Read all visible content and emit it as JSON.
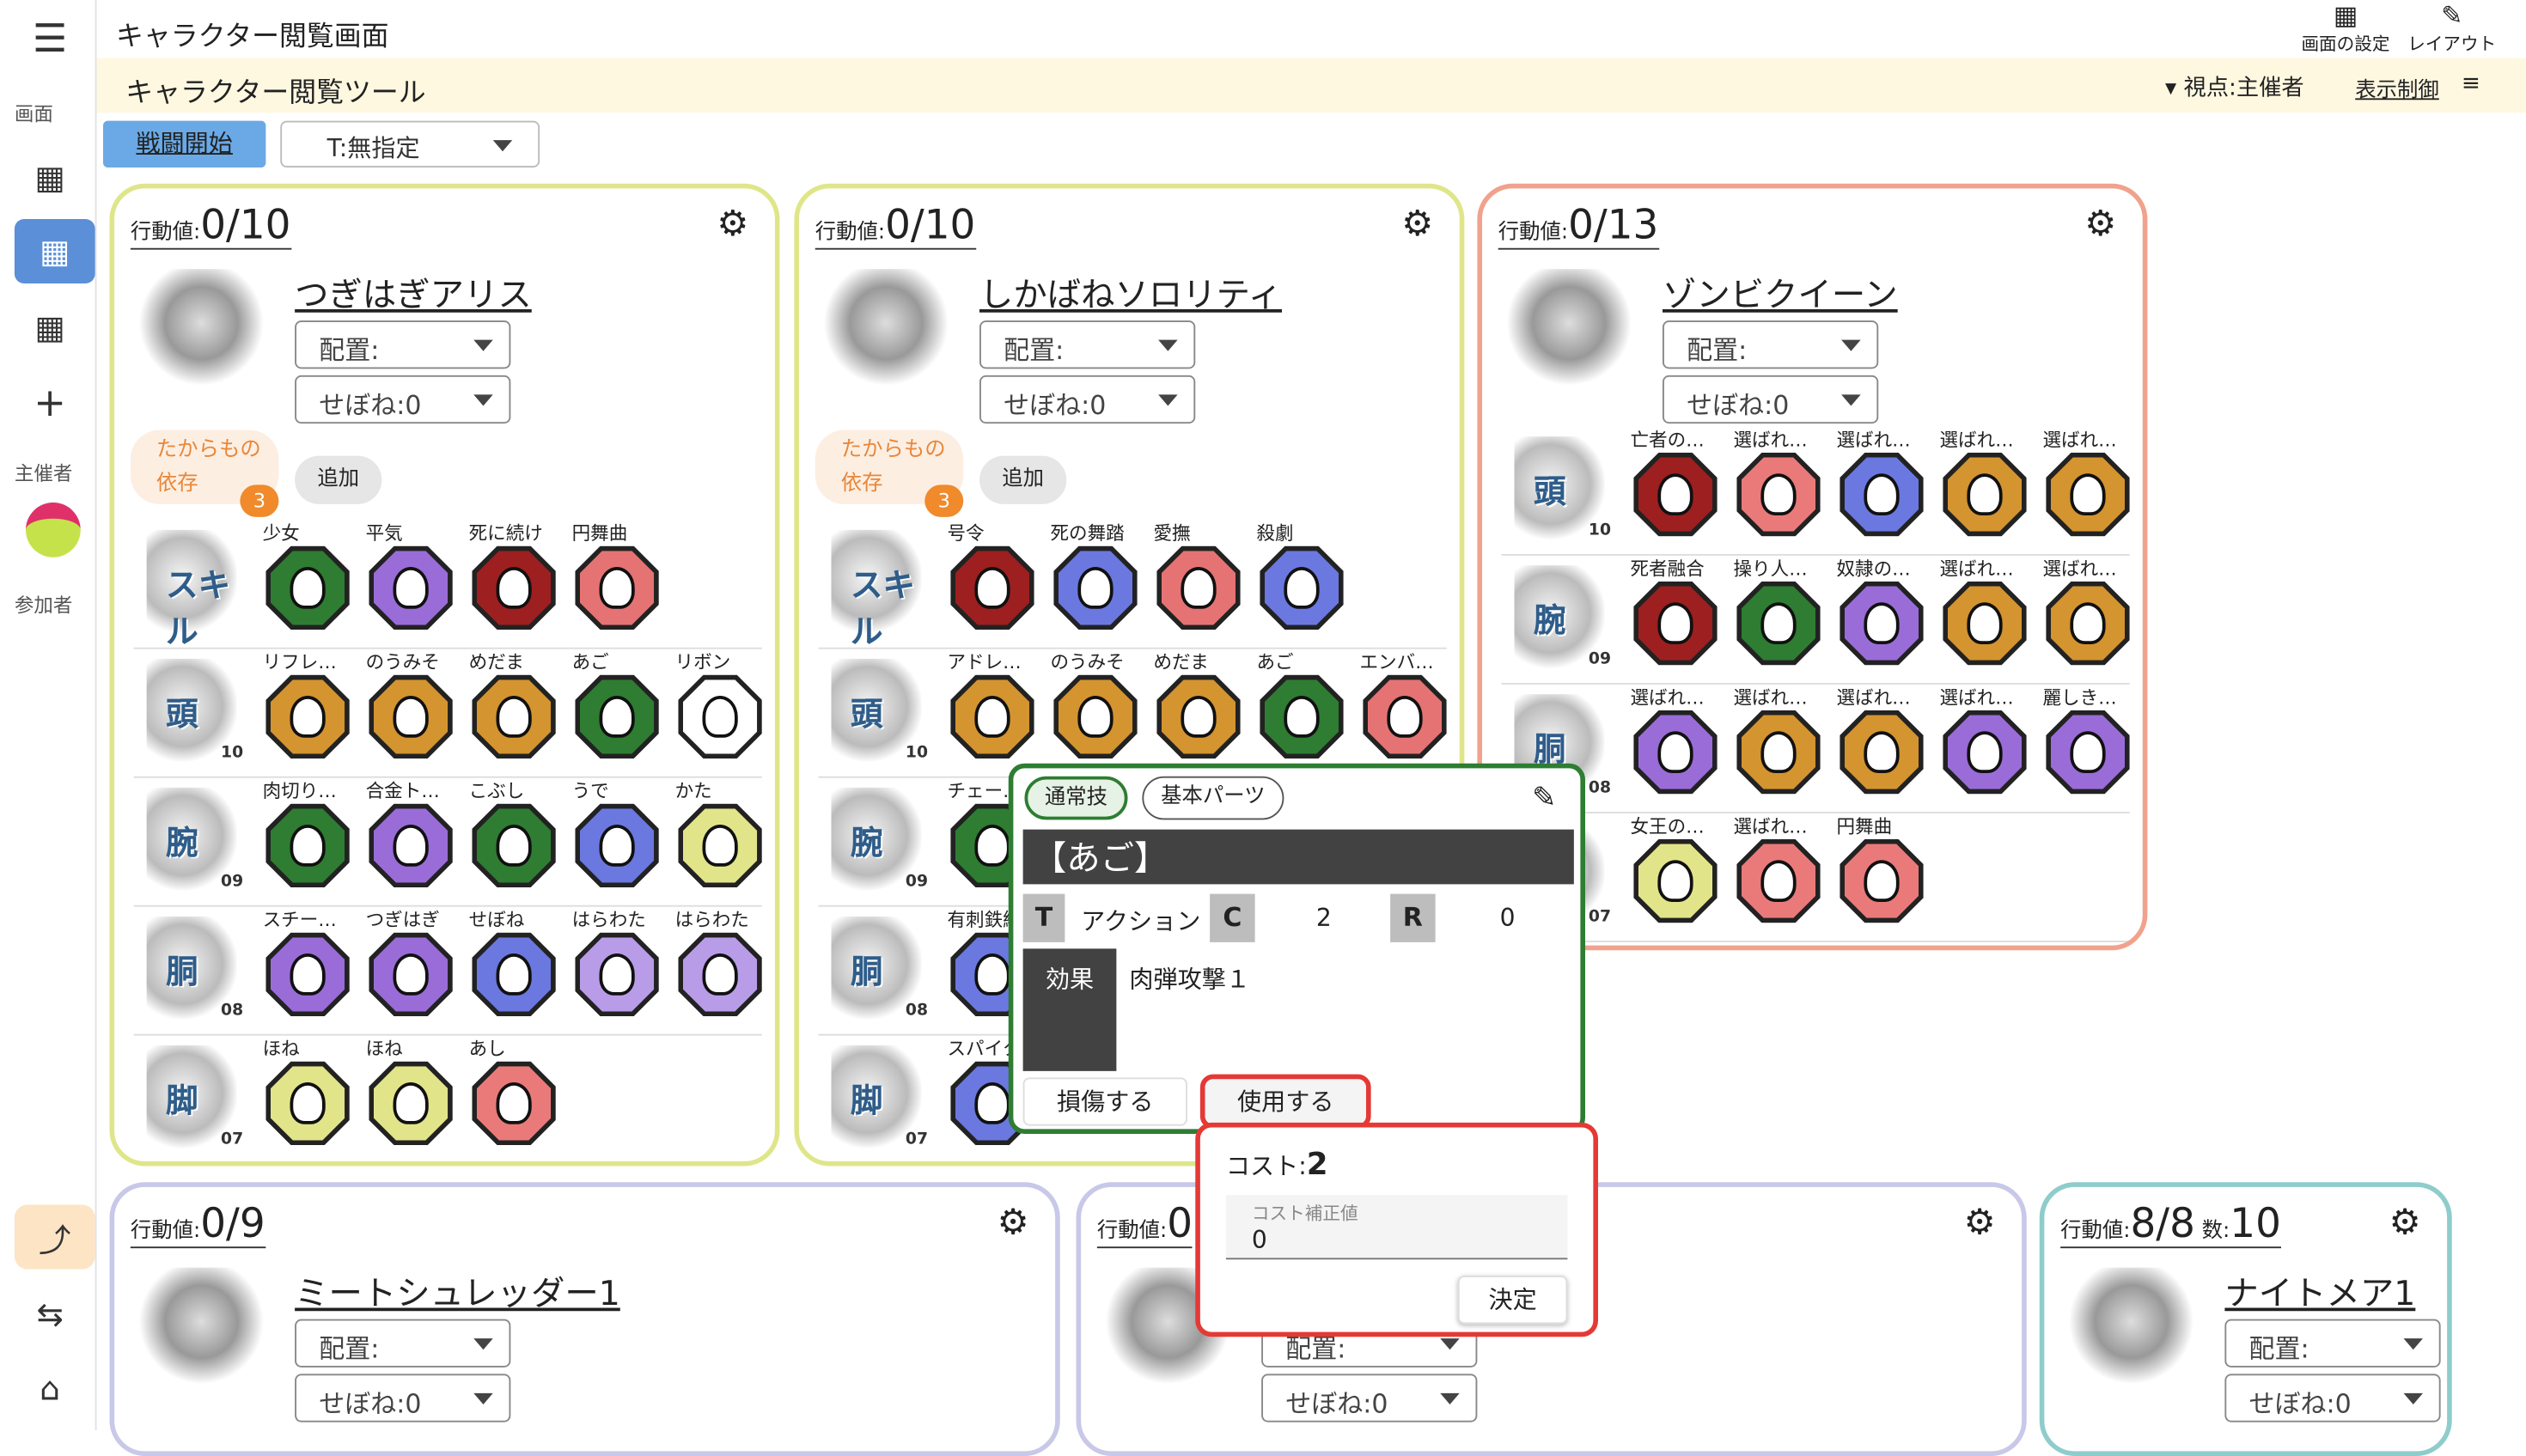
{
  "app": {
    "title": "キャラクター閲覧画面",
    "subtitle": "キャラクター閲覧ツール",
    "top_actions": [
      {
        "label": "画面の設定",
        "icon": "grid-icon"
      },
      {
        "label": "レイアウト",
        "icon": "tools-icon"
      }
    ],
    "viewpoint": "▾ 視点:主催者",
    "display_control": "表示制御",
    "battle_start": "戦闘開始",
    "timing_select": "T:無指定"
  },
  "rail": {
    "section_screen": "画面",
    "section_host": "主催者",
    "section_participant": "参加者"
  },
  "colors": {
    "accent": "#5b9bd5",
    "green": "#2e7d32",
    "red": "#e53935",
    "yellowBorder": "#dfe68a",
    "salmonBorder": "#f0a28d",
    "lavenderBorder": "#c8c8e8",
    "tealBorder": "#8fcccc"
  },
  "common": {
    "action_label": "行動値:",
    "place": "配置:",
    "sebone": "せぼね:0",
    "treasure": "たからもの\n依存",
    "treasure_count": "3",
    "add": "追加",
    "count_label": "数:"
  },
  "cards": [
    {
      "name": "つぎはぎアリス",
      "action": "0/10",
      "rows": [
        {
          "kind": "skill",
          "glyph": "スキル",
          "num": "",
          "parts": [
            [
              "少女",
              "#2e7d32"
            ],
            [
              "平気",
              "#9a6cd8"
            ],
            [
              "死に続け",
              "#9e1f1f"
            ],
            [
              "円舞曲",
              "#e57373"
            ]
          ]
        },
        {
          "kind": "head",
          "glyph": "頭",
          "num": "10",
          "parts": [
            [
              "リフレ…",
              "#d4942f"
            ],
            [
              "のうみそ",
              "#d4942f"
            ],
            [
              "めだま",
              "#d4942f"
            ],
            [
              "あご",
              "#2e7d32"
            ],
            [
              "リボン",
              "#ffffff"
            ]
          ]
        },
        {
          "kind": "arm",
          "glyph": "腕",
          "num": "09",
          "parts": [
            [
              "肉切り…",
              "#2e7d32"
            ],
            [
              "合金ト…",
              "#9a6cd8"
            ],
            [
              "こぶし",
              "#2e7d32"
            ],
            [
              "うで",
              "#6b78e0"
            ],
            [
              "かた",
              "#e2e48a"
            ]
          ]
        },
        {
          "kind": "body",
          "glyph": "胴",
          "num": "08",
          "parts": [
            [
              "スチー…",
              "#9a6cd8"
            ],
            [
              "つぎはぎ",
              "#9a6cd8"
            ],
            [
              "せぼね",
              "#6b78e0"
            ],
            [
              "はらわた",
              "#b99ce8"
            ],
            [
              "はらわた",
              "#b99ce8"
            ]
          ]
        },
        {
          "kind": "leg",
          "glyph": "脚",
          "num": "07",
          "parts": [
            [
              "ほね",
              "#e2e48a"
            ],
            [
              "ほね",
              "#e2e48a"
            ],
            [
              "あし",
              "#ea7a7a"
            ]
          ]
        }
      ]
    },
    {
      "name": "しかばねソロリティ",
      "action": "0/10",
      "rows": [
        {
          "kind": "skill",
          "glyph": "スキル",
          "num": "",
          "parts": [
            [
              "号令",
              "#9e1f1f"
            ],
            [
              "死の舞踏",
              "#6b78e0"
            ],
            [
              "愛撫",
              "#e57373"
            ],
            [
              "殺劇",
              "#6b78e0"
            ]
          ]
        },
        {
          "kind": "head",
          "glyph": "頭",
          "num": "10",
          "parts": [
            [
              "アドレ…",
              "#d4942f"
            ],
            [
              "のうみそ",
              "#d4942f"
            ],
            [
              "めだま",
              "#d4942f"
            ],
            [
              "あご",
              "#2e7d32"
            ],
            [
              "エンバ…",
              "#e57373"
            ]
          ]
        },
        {
          "kind": "arm",
          "glyph": "腕",
          "num": "09",
          "parts": [
            [
              "チェー…",
              "#2e7d32"
            ]
          ]
        },
        {
          "kind": "body",
          "glyph": "胴",
          "num": "08",
          "parts": [
            [
              "有刺鉄線",
              "#6b78e0"
            ]
          ]
        },
        {
          "kind": "leg",
          "glyph": "脚",
          "num": "07",
          "parts": [
            [
              "スパイク",
              "#6b78e0"
            ]
          ]
        }
      ]
    },
    {
      "name": "ゾンビクイーン",
      "action": "0/13",
      "rows": [
        {
          "kind": "head",
          "glyph": "頭",
          "num": "10",
          "parts": [
            [
              "亡者の…",
              "#9e1f1f"
            ],
            [
              "選ばれ…",
              "#ea7a7a"
            ],
            [
              "選ばれ…",
              "#6b78e0"
            ],
            [
              "選ばれ…",
              "#d4942f"
            ],
            [
              "選ばれ…",
              "#d4942f"
            ]
          ]
        },
        {
          "kind": "arm",
          "glyph": "腕",
          "num": "09",
          "parts": [
            [
              "死者融合",
              "#9e1f1f"
            ],
            [
              "操り人…",
              "#2e7d32"
            ],
            [
              "奴隷の…",
              "#9a6cd8"
            ],
            [
              "選ばれ…",
              "#d4942f"
            ],
            [
              "選ばれ…",
              "#d4942f"
            ]
          ]
        },
        {
          "kind": "body",
          "glyph": "胴",
          "num": "08",
          "parts": [
            [
              "選ばれ…",
              "#9a6cd8"
            ],
            [
              "選ばれ…",
              "#d4942f"
            ],
            [
              "選ばれ…",
              "#d4942f"
            ],
            [
              "選ばれ…",
              "#9a6cd8"
            ],
            [
              "麗しき…",
              "#9a6cd8"
            ]
          ]
        },
        {
          "kind": "leg",
          "glyph": "脚",
          "num": "07",
          "parts": [
            [
              "女王の…",
              "#e2e48a"
            ],
            [
              "選ばれ…",
              "#ea7a7a"
            ],
            [
              "円舞曲",
              "#ea7a7a"
            ]
          ]
        }
      ]
    },
    {
      "name": "ミートシュレッダー1",
      "action": "0/9"
    },
    {
      "name": "",
      "action": "0"
    },
    {
      "name": "ナイトメア1",
      "action": "8/8",
      "count": "10"
    }
  ],
  "popup": {
    "tab_active": "通常技",
    "tab_other": "基本パーツ",
    "title": "【あご】",
    "t": "T",
    "timing": "アクション",
    "c": "C",
    "cost": "2",
    "r": "R",
    "range": "0",
    "effect_label": "効果",
    "effect": "肉弾攻撃１",
    "damage_btn": "損傷する",
    "use_btn": "使用する"
  },
  "cost_popup": {
    "label": "コスト:",
    "value": "2",
    "field_label": "コスト補正値",
    "field_value": "0",
    "ok": "決定"
  }
}
